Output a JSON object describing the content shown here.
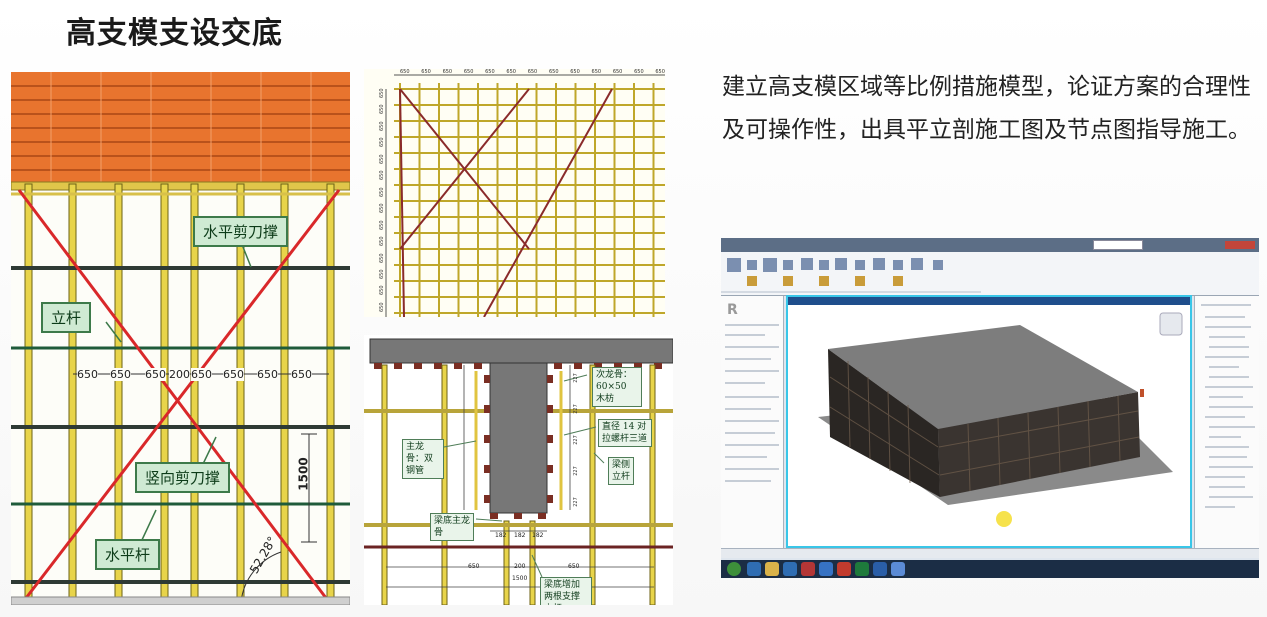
{
  "slide": {
    "title": "高支模支设交底",
    "description": "建立高支模区域等比例措施模型，论证方案的合理性及可操作性，出具平立剖施工图及节点图指导施工。"
  },
  "elevation_diagram": {
    "labels": {
      "horizontal_brace": "水平剪刀撑",
      "upright": "立杆",
      "vertical_brace": "竖向剪刀撑",
      "horizontal_bar": "水平杆"
    },
    "spacing_dims": [
      "650",
      "650",
      "650",
      "200",
      "650",
      "650",
      "650",
      "650"
    ],
    "height_dim": "1500",
    "angle": "52.28°"
  },
  "plan_diagram": {
    "top_dims": [
      "650",
      "650",
      "650",
      "650",
      "650",
      "650",
      "650",
      "650",
      "650",
      "650",
      "650",
      "650",
      "650"
    ],
    "side_dims": [
      "650",
      "650",
      "650",
      "650",
      "650",
      "650",
      "650",
      "650",
      "650",
      "650",
      "650",
      "650",
      "650",
      "650"
    ]
  },
  "beam_section": {
    "labels": {
      "secondary_joist": "次龙骨：60×50 木枋",
      "tie_bolt": "直径 14 对拉螺杆三道",
      "main_joist": "主龙骨：双钢管",
      "beam_side_pole": "梁侧立杆",
      "beam_bottom_main": "梁底主龙骨",
      "beam_bottom_support": "梁底增加两根支撑立杆"
    },
    "dims": {
      "bottom_a": "182",
      "bottom_b": "182",
      "bottom_c": "182",
      "span_left": "650",
      "span_mid": "200",
      "span_right": "650",
      "total": "1500",
      "vertical": [
        "227",
        "227",
        "227",
        "227",
        "227"
      ]
    }
  },
  "revit_screenshot": {
    "app_logo": "R"
  }
}
